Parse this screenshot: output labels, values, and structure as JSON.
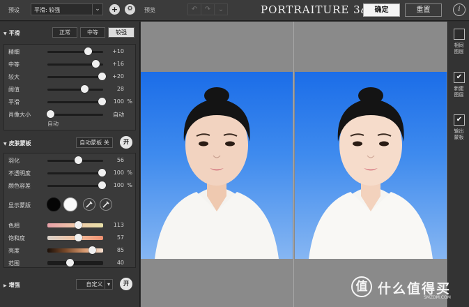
{
  "toolbar": {
    "preset_label": "预设",
    "preset_value": "平滑: 较强",
    "add_symbol": "+",
    "gear_symbol": "⚙",
    "preview_label": "预览",
    "undo_symbol": "↶",
    "redo_symbol": "↷",
    "history_symbol": "⌄",
    "brand_main": "PORTRAITURE 3",
    "brand_ai": "ai",
    "ok_label": "确定",
    "reset_label": "重置",
    "info_symbol": "i"
  },
  "smoothing": {
    "title": "平滑",
    "modes": [
      {
        "label": "正常",
        "active": false
      },
      {
        "label": "中等",
        "active": false
      },
      {
        "label": "较强",
        "active": true
      }
    ],
    "sliders": [
      {
        "label": "精细",
        "value": "+10",
        "unit": "",
        "pos": 0.72
      },
      {
        "label": "中等",
        "value": "+16",
        "unit": "",
        "pos": 0.86
      },
      {
        "label": "较大",
        "value": "+20",
        "unit": "",
        "pos": 0.97
      },
      {
        "label": "阈值",
        "value": "28",
        "unit": "",
        "pos": 0.66
      },
      {
        "label": "平滑",
        "value": "100",
        "unit": "%",
        "pos": 0.97
      },
      {
        "label": "肖像大小",
        "value": "自动",
        "unit": "",
        "pos": 0.05
      }
    ],
    "portrait_sub": "自动"
  },
  "skin_mask": {
    "title": "皮肤蒙板",
    "auto_mask_label": "自动蒙板 关",
    "toggle_label": "开",
    "sliders": [
      {
        "label": "羽化",
        "value": "56",
        "unit": "",
        "pos": 0.55
      },
      {
        "label": "不透明度",
        "value": "100",
        "unit": "%",
        "pos": 0.97
      },
      {
        "label": "颜色容差",
        "value": "100",
        "unit": "%",
        "pos": 0.97
      }
    ],
    "show_mask_label": "显示蒙版",
    "color_sliders": [
      {
        "label": "色相",
        "value": "113",
        "pos": 0.55,
        "gradient": "linear-gradient(90deg,#e8a0a8,#f0c8a8,#e8e0a8)"
      },
      {
        "label": "饱和度",
        "value": "57",
        "pos": 0.55,
        "gradient": "linear-gradient(90deg,#d8d0c8,#f0c0a0,#f09070)"
      },
      {
        "label": "亮度",
        "value": "85",
        "pos": 0.8,
        "gradient": "linear-gradient(90deg,#1a0f08,#7a4a2a,#d89a70,#f8e0d0)"
      },
      {
        "label": "范围",
        "value": "40",
        "pos": 0.4,
        "gradient": "#1c1c1c"
      }
    ]
  },
  "enhance": {
    "title": "增强",
    "custom_label": "自定义",
    "dropdown_symbol": "▾",
    "toggle_label": "开"
  },
  "right_panel": {
    "items": [
      {
        "label1": "相同",
        "label2": "图层",
        "checked": false
      },
      {
        "label1": "新建",
        "label2": "图层",
        "checked": true
      },
      {
        "label1": "输出",
        "label2": "蒙板",
        "checked": true
      }
    ]
  },
  "watermark": {
    "logo_char": "值",
    "text": "什么值得买",
    "sub": "SMZDM.COM"
  },
  "colors": {
    "panel_bg": "#353535",
    "preview_bg": "#8a8a8a",
    "photo_blue": "#1b6de8"
  }
}
